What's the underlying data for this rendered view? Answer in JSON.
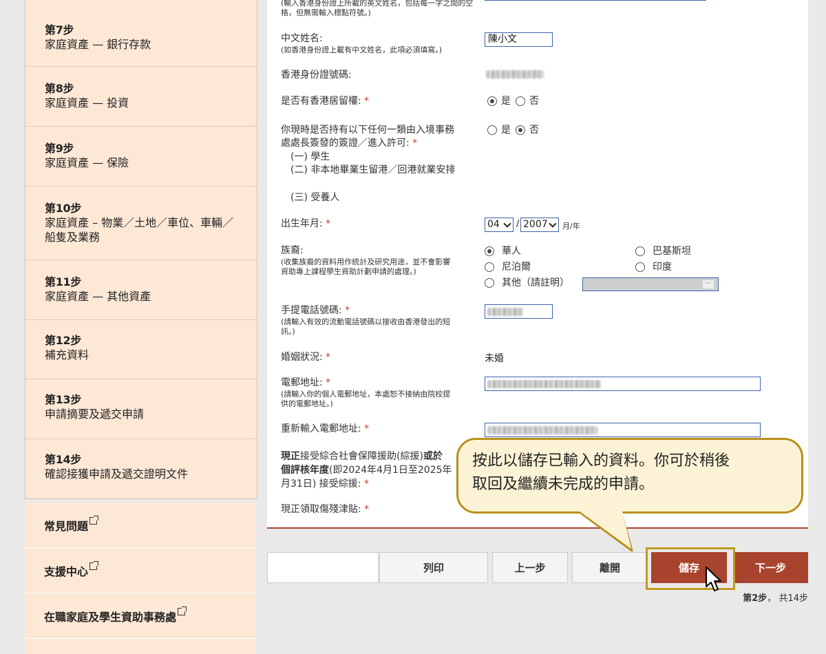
{
  "sidebar": {
    "steps": [
      {
        "num": "第7步",
        "label": "家庭資產 — 銀行存款"
      },
      {
        "num": "第8步",
        "label": "家庭資產 — 投資"
      },
      {
        "num": "第9步",
        "label": "家庭資產 — 保險"
      },
      {
        "num": "第10步",
        "label": "家庭資產 – 物業／土地／車位、車輛／船隻及業務"
      },
      {
        "num": "第11步",
        "label": "家庭資產 — 其他資產"
      },
      {
        "num": "第12步",
        "label": "補充資料"
      },
      {
        "num": "第13步",
        "label": "申請摘要及遞交申請"
      },
      {
        "num": "第14步",
        "label": "確認接獲申請及遞交證明文件"
      }
    ],
    "links": [
      {
        "label": "常見問題"
      },
      {
        "label": "支援中心"
      },
      {
        "label": "在職家庭及學生資助事務處"
      }
    ]
  },
  "form": {
    "top_note": "(輸入香港身份證上所載的英文姓名，包括每一字之間的空格，但無需輸入標點符號。)",
    "chinese_name": {
      "label": "中文姓名:",
      "note": "(如香港身份證上載有中文姓名，此項必須填寫。)",
      "value": "陳小文"
    },
    "hkid": {
      "label": "香港身份證號碼:"
    },
    "right_of_abode": {
      "label": "是否有香港居留權:",
      "options": [
        "是",
        "否"
      ],
      "selected": "是"
    },
    "visa": {
      "label_line1": "你現時是否持有以下任何一類由入境事務",
      "label_line2": "處處長簽發的簽證／進入許可:",
      "items": [
        "(一) 學生",
        "(二) 非本地畢業生留港／回港就業安排",
        "(三) 受養人"
      ],
      "options": [
        "是",
        "否"
      ],
      "selected": "否"
    },
    "dob": {
      "label": "出生年月:",
      "month": "04",
      "year": "2007",
      "separator": "/",
      "unit": "月/年"
    },
    "ethnicity": {
      "label": "族裔:",
      "note_line1": "(收集族裔的資料用作統計及研究用途，並不會影響",
      "note_line2": "資助專上課程學生資助計劃申請的處理。)",
      "options": [
        "華人",
        "巴基斯坦",
        "尼泊爾",
        "印度",
        "其他（請註明）"
      ],
      "selected": "華人",
      "other_dots": "···"
    },
    "mobile": {
      "label": "手提電話號碼:",
      "note_line1": "(請輸入有效的流動電話號碼以接收由香港發出的短",
      "note_line2": "訊。)"
    },
    "marital": {
      "label": "婚姻狀況:",
      "value": "未婚"
    },
    "email": {
      "label": "電郵地址:",
      "note_line1": "(請輸入你的個人電郵地址，本處恕不接納由院校提",
      "note_line2": "供的電郵地址。)"
    },
    "email_confirm": {
      "label": "重新輸入電郵地址:"
    },
    "cssa": {
      "line1_bold": "現正",
      "line1_rest": "接受綜合社會保障援助(綜援)",
      "line1_tail": "或於",
      "line2_bold": "個評核年度",
      "line2_rest": "(即2024年4月1日至2025年",
      "line3": "月31日) 接受綜援:"
    },
    "disability": {
      "label": "現正領取傷殘津貼:"
    }
  },
  "toolbar": {
    "print": "列印",
    "prev": "上一步",
    "leave": "離開",
    "save": "儲存",
    "next": "下一步",
    "pager_step": "第2步",
    "pager_total": "共14步"
  },
  "callout": {
    "line1": "按此以儲存已輸入的資料。你可於稍後",
    "line2": "取回及繼續未完成的申請。"
  },
  "colors": {
    "accent": "#a8432d",
    "sidebar_bg": "#fde8d6",
    "callout_border": "#b9901b",
    "callout_bg": "#fcf3d6",
    "required": "#c0392b"
  }
}
